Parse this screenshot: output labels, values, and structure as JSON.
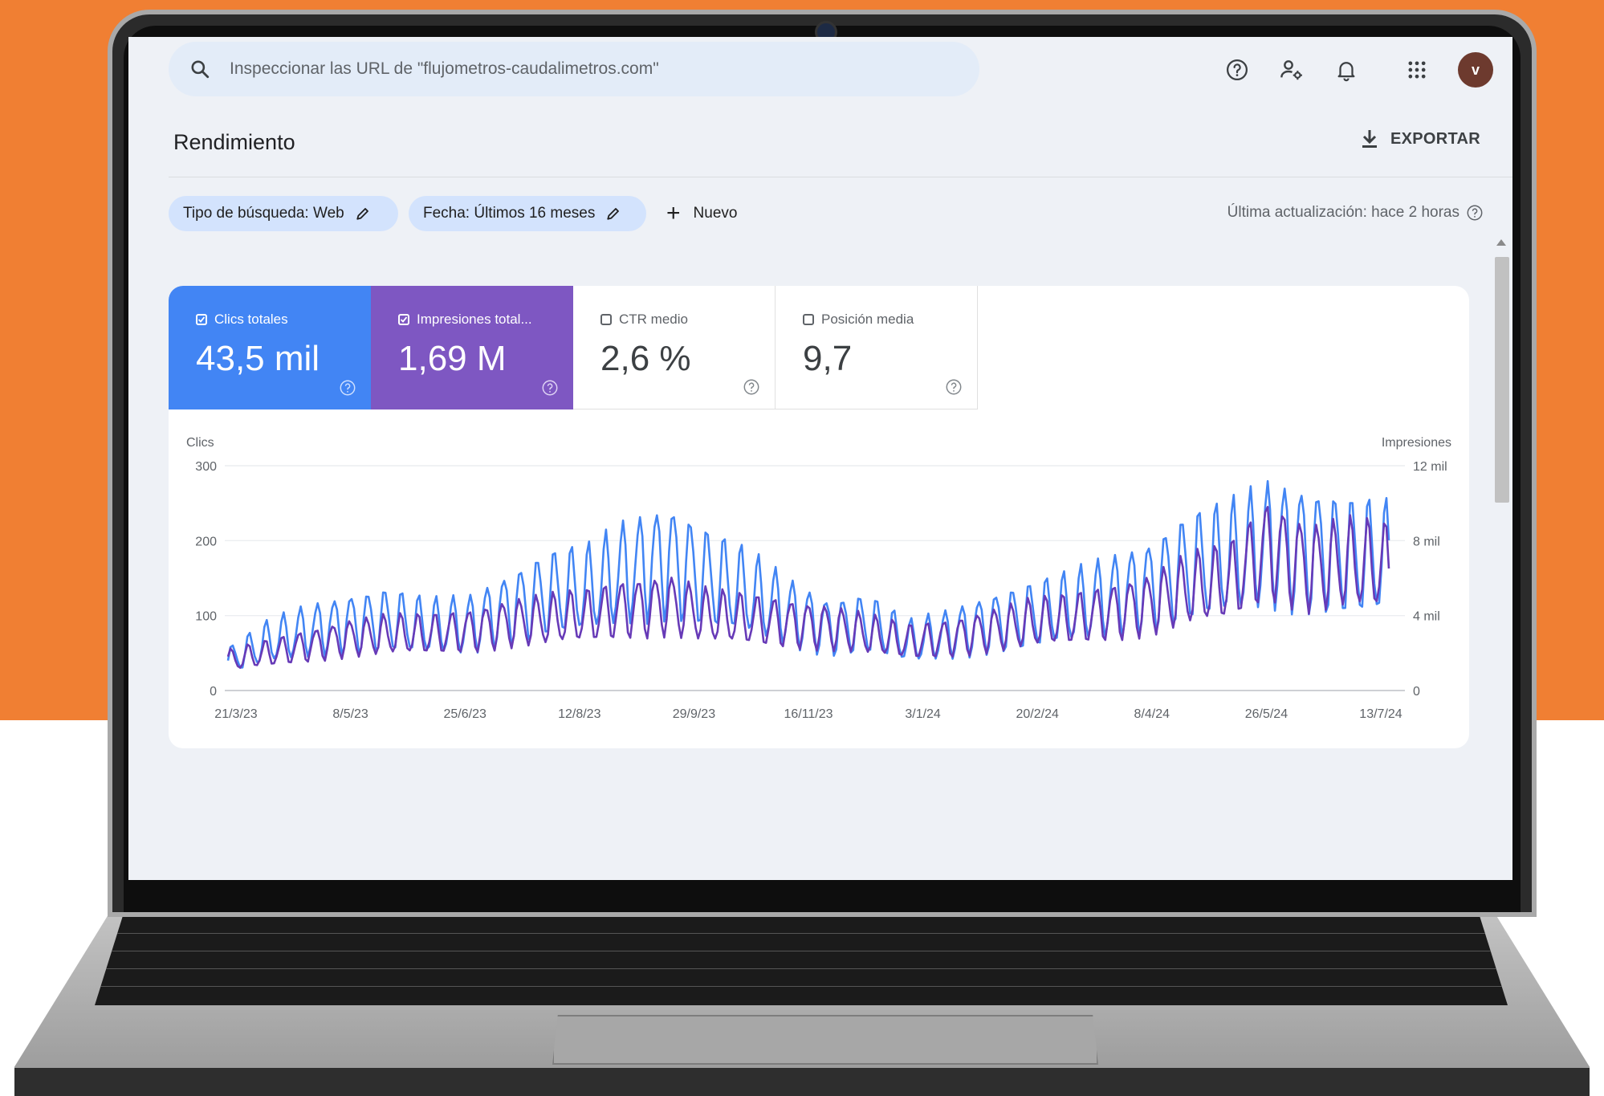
{
  "search": {
    "placeholder": "Inspeccionar las URL de \"flujometros-caudalimetros.com\""
  },
  "header": {
    "icons": [
      "help-icon",
      "manage-users-icon",
      "notifications-icon",
      "apps-grid-icon"
    ],
    "avatar_letter": "v"
  },
  "page": {
    "title": "Rendimiento",
    "export_label": "EXPORTAR",
    "updated_text": "Última actualización: hace 2 horas"
  },
  "filters": {
    "search_type": "Tipo de búsqueda: Web",
    "date": "Fecha: Últimos 16 meses",
    "new_label": "Nuevo"
  },
  "metrics": [
    {
      "label": "Clics totales",
      "value": "43,5 mil",
      "checked": true,
      "color": "#4285f4"
    },
    {
      "label": "Impresiones total...",
      "value": "1,69 M",
      "checked": true,
      "color": "#7e57c2"
    },
    {
      "label": "CTR medio",
      "value": "2,6 %",
      "checked": false
    },
    {
      "label": "Posición media",
      "value": "9,7",
      "checked": false
    }
  ],
  "chart_data": {
    "type": "line",
    "left_axis_label": "Clics",
    "right_axis_label": "Impresiones",
    "left_ticks": [
      "300",
      "200",
      "100",
      "0"
    ],
    "right_ticks": [
      "12 mil",
      "8 mil",
      "4 mil",
      "0"
    ],
    "ylim_left": [
      0,
      300
    ],
    "ylim_right": [
      0,
      12000
    ],
    "x_ticks": [
      "21/3/23",
      "8/5/23",
      "25/6/23",
      "12/8/23",
      "29/9/23",
      "16/11/23",
      "3/1/24",
      "20/2/24",
      "8/4/24",
      "26/5/24",
      "13/7/24"
    ],
    "grid": true,
    "series": [
      {
        "color": "#4285f4",
        "axis": "left",
        "values": [
          40,
          65,
          80,
          90,
          95,
          85,
          88,
          110,
          130,
          135,
          160,
          175,
          150,
          130,
          105,
          85,
          90,
          65,
          75,
          90,
          100,
          110,
          125,
          140,
          165,
          175,
          195,
          190,
          180,
          175
        ]
      },
      {
        "color": "#673ab7",
        "axis": "right",
        "values": [
          1600,
          2000,
          2400,
          2800,
          3000,
          3000,
          3200,
          3600,
          3800,
          4000,
          4400,
          4600,
          4000,
          3800,
          3600,
          3400,
          3000,
          2600,
          2800,
          3200,
          3600,
          3800,
          4200,
          4600,
          5400,
          5800,
          7600,
          6600,
          6800,
          6600
        ]
      }
    ]
  }
}
